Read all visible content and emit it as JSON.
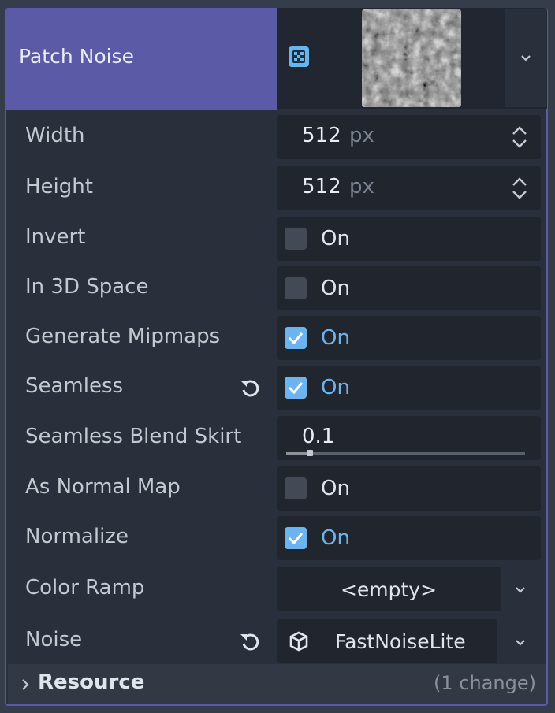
{
  "header": {
    "title": "Patch Noise",
    "resource_icon": "noise-texture-icon",
    "dropdown_icon": "chevron-down-icon"
  },
  "properties": {
    "width": {
      "label": "Width",
      "value": "512",
      "unit": "px"
    },
    "height": {
      "label": "Height",
      "value": "512",
      "unit": "px"
    },
    "invert": {
      "label": "Invert",
      "checked": false,
      "text": "On"
    },
    "in_3d_space": {
      "label": "In 3D Space",
      "checked": false,
      "text": "On"
    },
    "generate_mipmaps": {
      "label": "Generate Mipmaps",
      "checked": true,
      "text": "On"
    },
    "seamless": {
      "label": "Seamless",
      "checked": true,
      "text": "On",
      "revert_icon": "revert-icon"
    },
    "seamless_blend_skirt": {
      "label": "Seamless Blend Skirt",
      "value": "0.1",
      "slider_fraction": 0.1
    },
    "as_normal_map": {
      "label": "As Normal Map",
      "checked": false,
      "text": "On"
    },
    "normalize": {
      "label": "Normalize",
      "checked": true,
      "text": "On"
    },
    "color_ramp": {
      "label": "Color Ramp",
      "value": "<empty>"
    },
    "noise": {
      "label": "Noise",
      "value": "FastNoiseLite",
      "icon": "cube-icon",
      "revert_icon": "revert-icon"
    }
  },
  "resource": {
    "label": "Resource",
    "changes": "(1 change)"
  },
  "colors": {
    "accent": "#5a5aa6",
    "checked": "#6cb4f0",
    "field_bg": "#20252e"
  }
}
